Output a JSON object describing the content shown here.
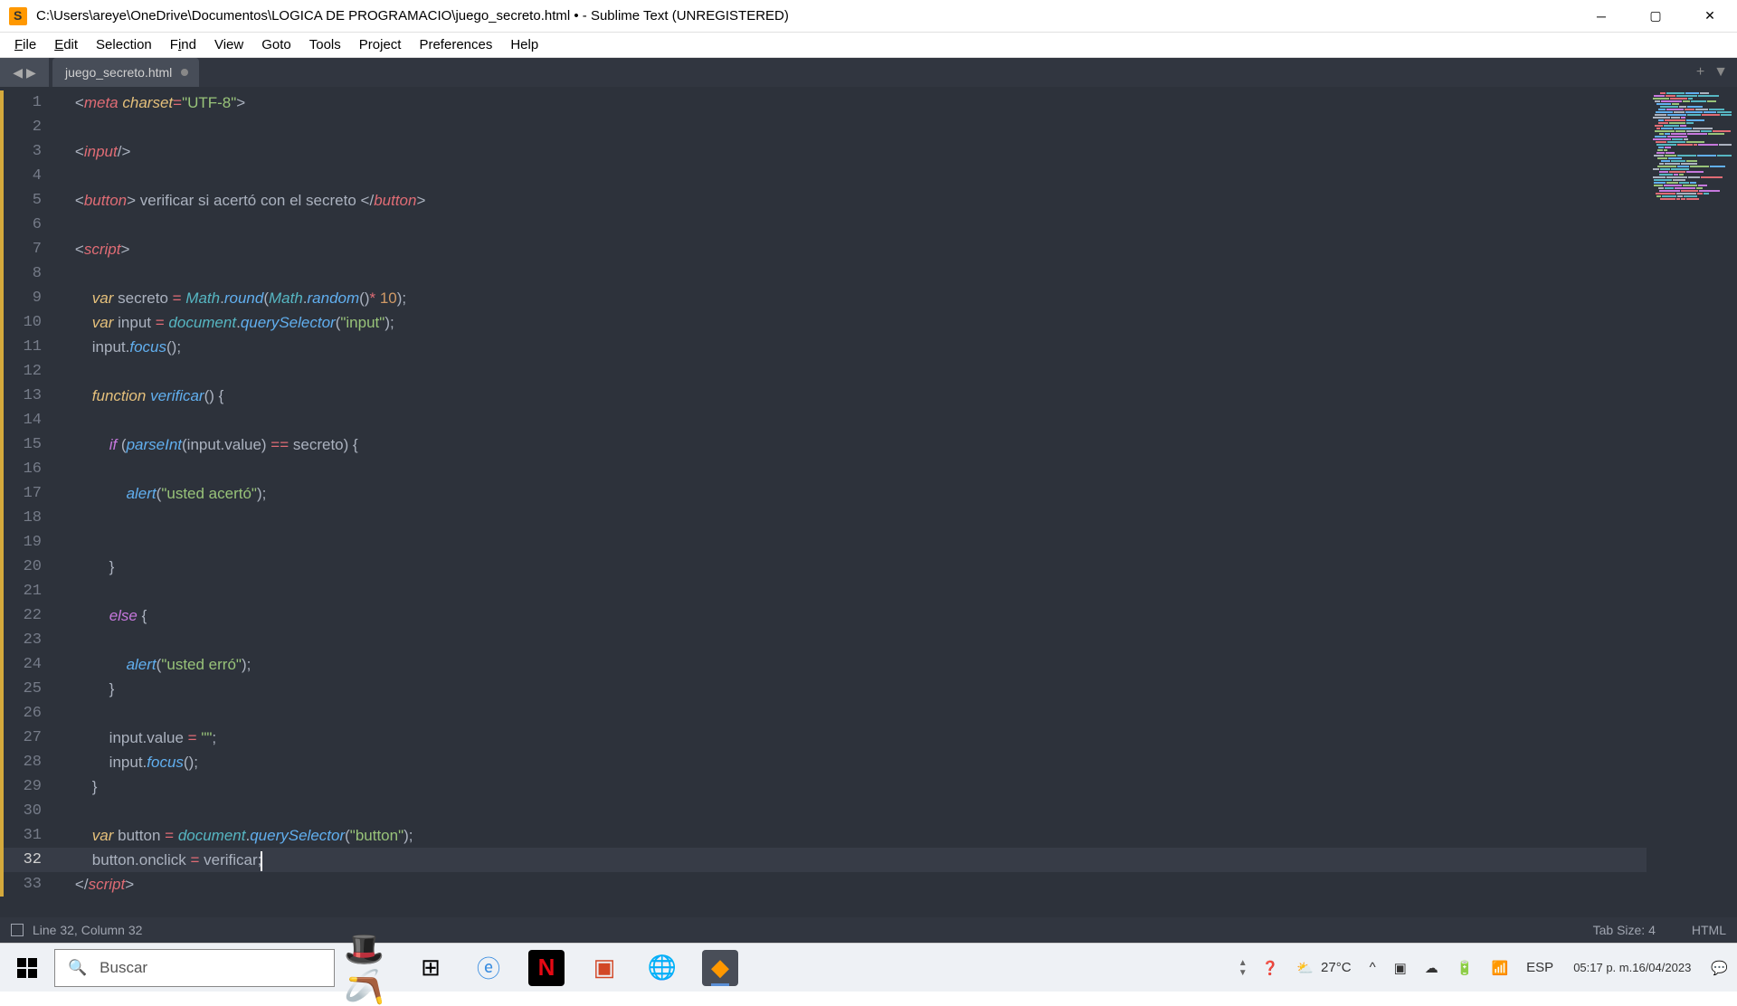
{
  "window": {
    "title": "C:\\Users\\areye\\OneDrive\\Documentos\\LOGICA DE PROGRAMACIO\\juego_secreto.html • - Sublime Text (UNREGISTERED)"
  },
  "menu": {
    "file": "File",
    "edit": "Edit",
    "selection": "Selection",
    "find": "Find",
    "view": "View",
    "goto": "Goto",
    "tools": "Tools",
    "project": "Project",
    "preferences": "Preferences",
    "help": "Help"
  },
  "tab": {
    "name": "juego_secreto.html"
  },
  "lines": {
    "start": 1,
    "end": 33,
    "active": 32,
    "modified": [
      1,
      2,
      3,
      4,
      5,
      6,
      7,
      8,
      9,
      10,
      11,
      12,
      13,
      14,
      15,
      16,
      17,
      18,
      19,
      20,
      21,
      22,
      23,
      24,
      25,
      26,
      27,
      28,
      29,
      30,
      31,
      32,
      33
    ]
  },
  "code": {
    "l1": {
      "indent": "    ",
      "pre": "<",
      "tag": "meta",
      "sp": " ",
      "attr": "charset",
      "eq": "=",
      "q1": "\"",
      "val": "UTF-8",
      "q2": "\"",
      "post": ">"
    },
    "l3": {
      "indent": "    ",
      "pre": "<",
      "tag": "input",
      "post": "/>"
    },
    "l5": {
      "indent": "    ",
      "pre": "<",
      "tag": "button",
      "mid": "> verificar si acertó con el secreto </",
      "tag2": "button",
      "post": ">"
    },
    "l7": {
      "indent": "    ",
      "pre": "<",
      "tag": "script",
      "post": ">"
    },
    "l9": {
      "indent": "        ",
      "kw": "var",
      "sp": " ",
      "name": "secreto ",
      "op": "=",
      "sp2": " ",
      "obj": "Math",
      "dot": ".",
      "fn": "round",
      "p1": "(",
      "obj2": "Math",
      "dot2": ".",
      "fn2": "random",
      "p2": "()",
      "op2": "*",
      "sp3": " ",
      "num": "10",
      "p3": ");"
    },
    "l10": {
      "indent": "        ",
      "kw": "var",
      "sp": " ",
      "name": "input ",
      "op": "=",
      "sp2": " ",
      "obj": "document",
      "dot": ".",
      "fn": "querySelector",
      "p1": "(",
      "q1": "\"",
      "str": "input",
      "q2": "\"",
      "p2": ");"
    },
    "l11": {
      "indent": "        ",
      "name": "input",
      "dot": ".",
      "fn": "focus",
      "p": "();"
    },
    "l13": {
      "indent": "        ",
      "kw": "function",
      "sp": " ",
      "fn": "verificar",
      "p": "() {"
    },
    "l15": {
      "indent": "            ",
      "kw": "if",
      "sp": " (",
      "fn": "parseInt",
      "p1": "(input",
      "dot": ".",
      "name": "value) ",
      "op": "==",
      "sp2": " secreto) {"
    },
    "l17": {
      "indent": "                ",
      "fn": "alert",
      "p1": "(",
      "q1": "\"",
      "str": "usted acertó",
      "q2": "\"",
      "p2": ");"
    },
    "l20": {
      "indent": "            ",
      "brace": "}"
    },
    "l22": {
      "indent": "            ",
      "kw": "else",
      "sp": " {"
    },
    "l24": {
      "indent": "                ",
      "fn": "alert",
      "p1": "(",
      "q1": "\"",
      "str": "usted erró",
      "q2": "\"",
      "p2": ");"
    },
    "l25": {
      "indent": "            ",
      "brace": "}"
    },
    "l27": {
      "indent": "            ",
      "name": "input",
      "dot": ".",
      "prop": "value ",
      "op": "=",
      "sp": " ",
      "q1": "\"",
      "q2": "\"",
      "semi": ";"
    },
    "l28": {
      "indent": "            ",
      "name": "input",
      "dot": ".",
      "fn": "focus",
      "p": "();"
    },
    "l29": {
      "indent": "        ",
      "brace": "}"
    },
    "l31": {
      "indent": "        ",
      "kw": "var",
      "sp": " ",
      "name": "button ",
      "op": "=",
      "sp2": " ",
      "obj": "document",
      "dot": ".",
      "fn": "querySelector",
      "p1": "(",
      "q1": "\"",
      "str": "button",
      "q2": "\"",
      "p2": ");"
    },
    "l32": {
      "indent": "        ",
      "name": "button",
      "dot": ".",
      "prop": "onclick ",
      "op": "=",
      "sp": " verificar;",
      "cursor": true
    },
    "l33": {
      "indent": "    ",
      "pre": "</",
      "tag": "script",
      "post": ">"
    }
  },
  "statusbar": {
    "pos": "Line 32, Column 32",
    "tabsize": "Tab Size: 4",
    "syntax": "HTML"
  },
  "taskbar": {
    "search_placeholder": "Buscar",
    "weather": "27°C",
    "lang": "ESP",
    "time": "05:17 p. m.",
    "date": "16/04/2023"
  }
}
